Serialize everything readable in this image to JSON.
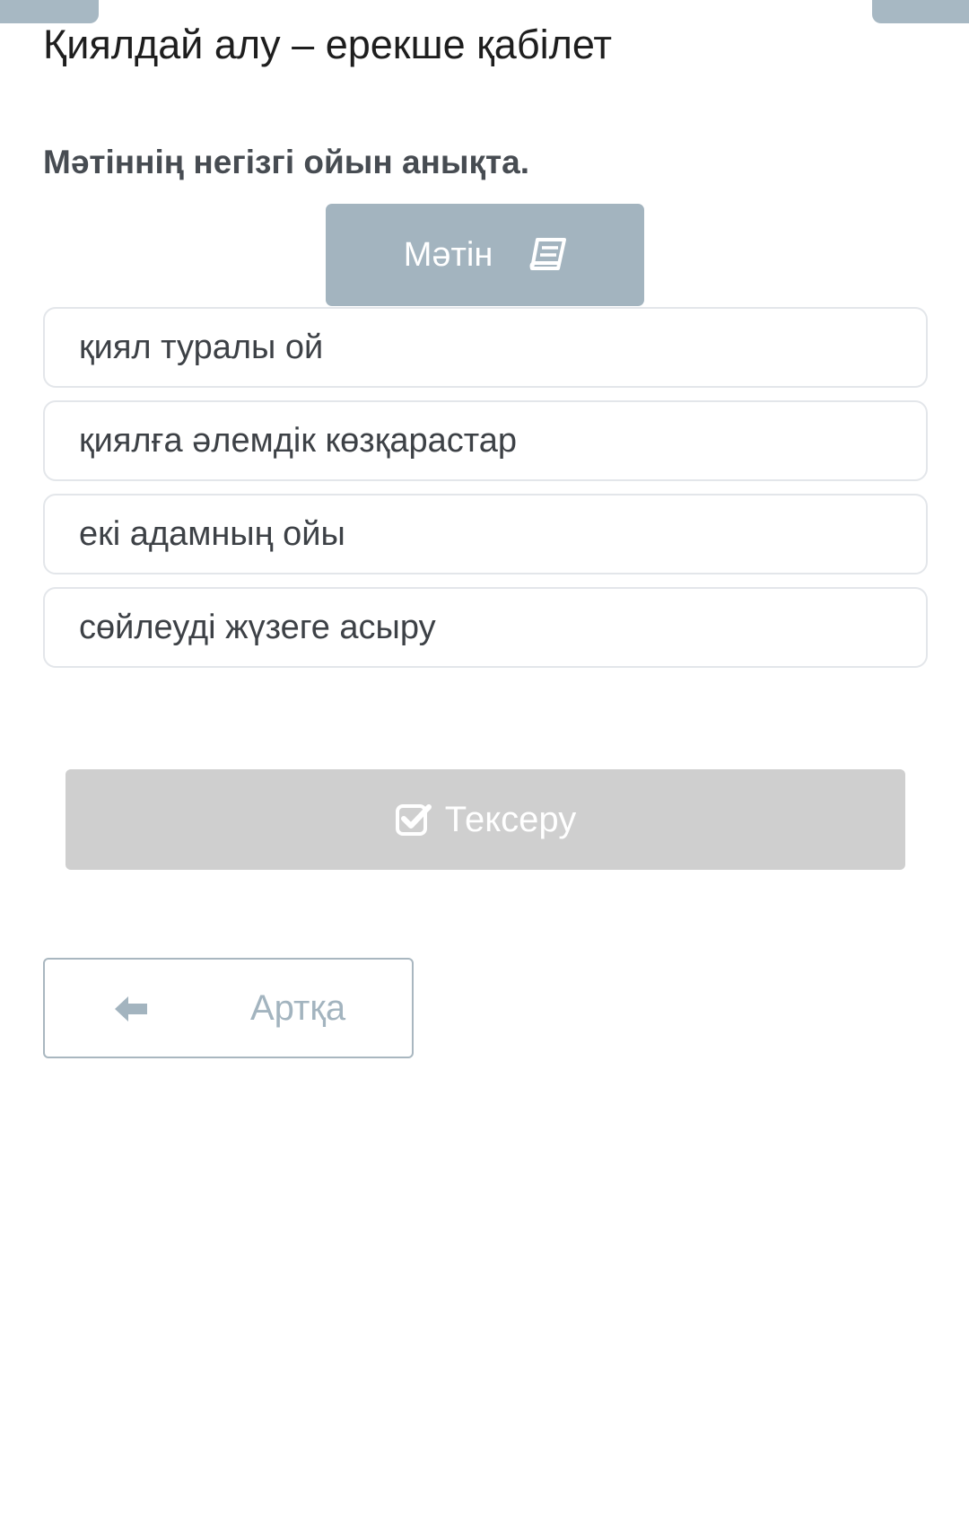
{
  "page": {
    "title": "Қиялдай алу – ерекше қабілет",
    "question": "Мәтіннің негізгі ойын анықта."
  },
  "text_button": {
    "label": "Мәтін",
    "icon": "book-icon"
  },
  "options": [
    "қиял туралы ой",
    "қиялға әлемдік көзқарастар",
    "екі адамның ойы",
    "сөйлеуді жүзеге асыру"
  ],
  "check_button": {
    "label": "Тексеру",
    "icon": "check-square-icon"
  },
  "back_button": {
    "label": "Артқа",
    "icon": "arrow-left-icon"
  },
  "colors": {
    "accent": "#a3b4bf",
    "disabled": "#cfcfcf",
    "option_border": "#e3e6ea"
  }
}
